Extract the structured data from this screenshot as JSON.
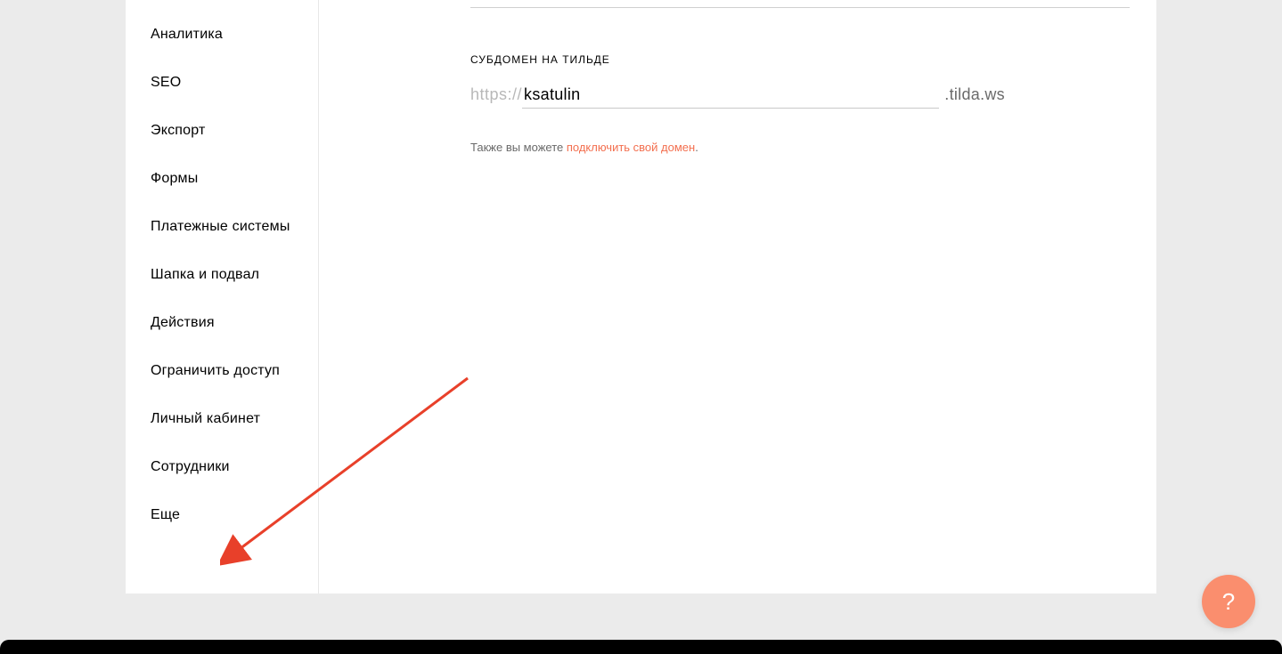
{
  "sidebar": {
    "items": [
      {
        "label": "Аналитика"
      },
      {
        "label": "SEO"
      },
      {
        "label": "Экспорт"
      },
      {
        "label": "Формы"
      },
      {
        "label": "Платежные системы"
      },
      {
        "label": "Шапка и подвал"
      },
      {
        "label": "Действия"
      },
      {
        "label": "Ограничить доступ"
      },
      {
        "label": "Личный кабинет"
      },
      {
        "label": "Сотрудники"
      },
      {
        "label": "Еще"
      }
    ]
  },
  "content": {
    "subdomain_label": "СУБДОМЕН НА ТИЛЬДЕ",
    "subdomain_prefix": "https://",
    "subdomain_value": "ksatulin",
    "subdomain_suffix": ".tilda.ws",
    "helper_text_prefix": "Также вы можете ",
    "helper_link": "подключить свой домен",
    "helper_text_suffix": "."
  },
  "help": {
    "glyph": "?"
  }
}
